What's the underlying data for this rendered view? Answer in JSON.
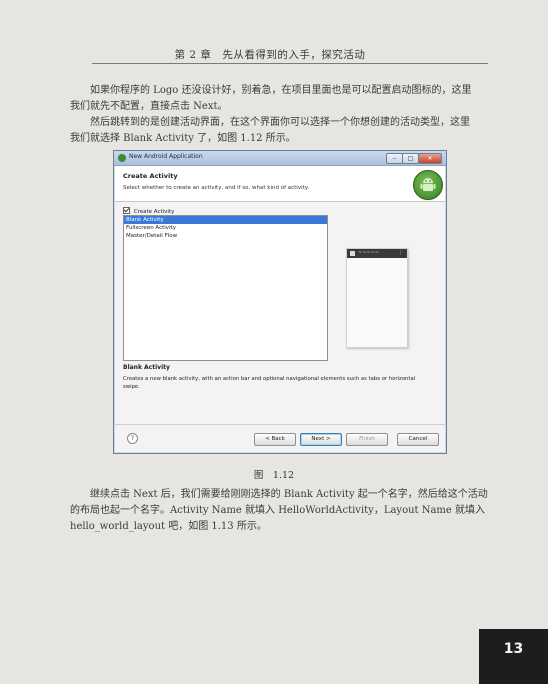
{
  "header": {
    "title": "第 2 章　先从看得到的入手，探究活动"
  },
  "paragraphs": {
    "p1_l1": "如果你程序的 Logo 还没设计好，别着急，在项目里面也是可以配置启动图标的，这里",
    "p1_l2": "我们就先不配置，直接点击 Next。",
    "p2_l1": "然后跳转到的是创建活动界面，在这个界面你可以选择一个你想创建的活动类型，这里",
    "p2_l2": "我们就选择 Blank Activity 了，如图 1.12 所示。",
    "p3_l1": "继续点击 Next 后，我们需要给刚刚选择的 Blank Activity 起一个名字，然后给这个活动",
    "p3_l2": "的布局也起一个名字。Activity Name 就填入 HelloWorldActivity，Layout Name 就填入",
    "p3_l3": "hello_world_layout 吧，如图 1.13 所示。"
  },
  "dialog": {
    "window_title": "New Android Application",
    "win_buttons": {
      "minimize": "–",
      "maximize": "□",
      "close": "✕"
    },
    "banner_title": "Create Activity",
    "banner_subtitle": "Select whether to create an activity, and if so, what kind of activity.",
    "checkbox_label": "Create Activity",
    "templates": [
      "Blank Activity",
      "Fullscreen Activity",
      "Master/Detail Flow"
    ],
    "selected_template_index": 0,
    "preview_wave": "~~~~~",
    "preview_menu": "⋮",
    "description_title": "Blank Activity",
    "description_text": "Creates a new blank activity, with an action bar and optional navigational elements such as tabs or horizontal swipe.",
    "help_symbol": "?",
    "buttons": {
      "back": "< Back",
      "next": "Next >",
      "finish": "Finish",
      "cancel": "Cancel"
    }
  },
  "figure": {
    "caption": "图　1.12"
  },
  "page_number": "13"
}
